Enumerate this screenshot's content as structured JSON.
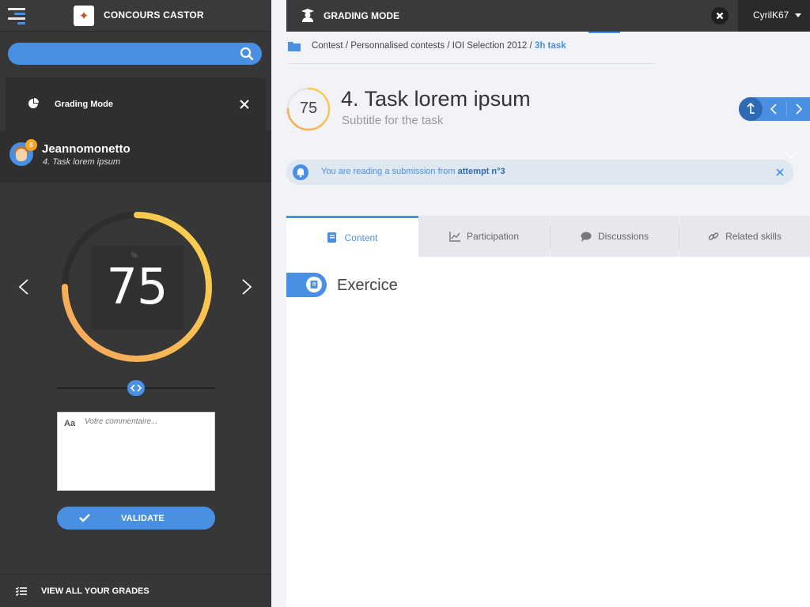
{
  "sidebar": {
    "app_title": "CONCOURS CASTOR",
    "search": {
      "placeholder": "",
      "value": ""
    },
    "grading_card": {
      "label": "Grading Mode"
    },
    "user": {
      "name": "Jeannomonetto",
      "task": "4. Task lorem ipsum",
      "badge": "5"
    },
    "score": {
      "value": "75",
      "unit": "%",
      "fraction": 0.75
    },
    "slider": {
      "fraction": 0.5
    },
    "comment": {
      "prefix": "Aa",
      "placeholder": "Votre commentaire..."
    },
    "validate_label": "VALIDATE",
    "all_grades_label": "VIEW ALL YOUR GRADES"
  },
  "topbar": {
    "mode_label": "GRADING MODE",
    "username": "CyrilK67"
  },
  "breadcrumb": {
    "path": "Contest / Personnalised contests / IOI Selection 2012 /",
    "current": "3h task"
  },
  "task": {
    "score": "75",
    "score_fraction": 0.75,
    "title": "4. Task lorem ipsum",
    "subtitle": "Subtitle for the task"
  },
  "notice": {
    "text": "You are reading a submission from",
    "highlight": "attempt n°3"
  },
  "tabs": [
    {
      "label": "Content",
      "icon": "book-icon"
    },
    {
      "label": "Participation",
      "icon": "chart-icon"
    },
    {
      "label": "Discussions",
      "icon": "chat-icon"
    },
    {
      "label": "Related skills",
      "icon": "link-icon"
    }
  ],
  "content": {
    "section_title": "Exercice"
  },
  "colors": {
    "accent": "#4a90e2",
    "gauge_start": "#f5a65b",
    "gauge_end": "#fcd34d",
    "dark": "#373737"
  }
}
